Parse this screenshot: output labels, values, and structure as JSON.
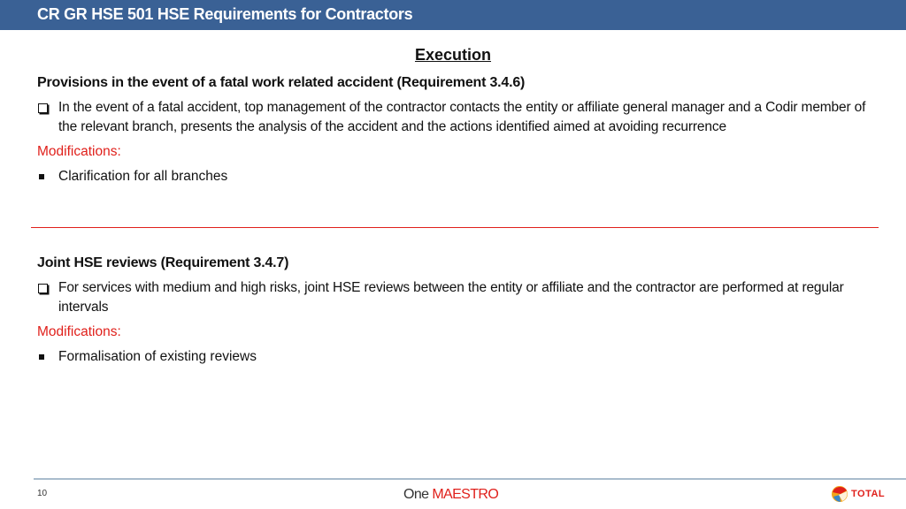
{
  "header": {
    "title": "CR GR HSE 501 HSE Requirements for Contractors"
  },
  "section_heading": "Execution",
  "sections": [
    {
      "title": "Provisions in the event of a fatal work related accident (Requirement 3.4.6)",
      "item": "In the event of a fatal accident, top management of the contractor contacts the entity or affiliate general manager and a Codir member of the relevant branch, presents the analysis of the accident and the actions identified aimed at avoiding recurrence",
      "modifications_label": "Modifications:",
      "modification": "Clarification for all branches"
    },
    {
      "title": "Joint HSE reviews (Requirement 3.4.7)",
      "item": "For services with medium and high risks, joint HSE reviews between the entity or affiliate and the contractor are performed at regular intervals",
      "modifications_label": "Modifications:",
      "modification": "Formalisation of existing reviews"
    }
  ],
  "footer": {
    "page_number": "10",
    "brand_one": "One",
    "brand_maestro": "MAESTRO",
    "logo_text": "TOTAL",
    "colors": {
      "accent_red": "#e0201b",
      "header_blue": "#3a6195"
    }
  }
}
